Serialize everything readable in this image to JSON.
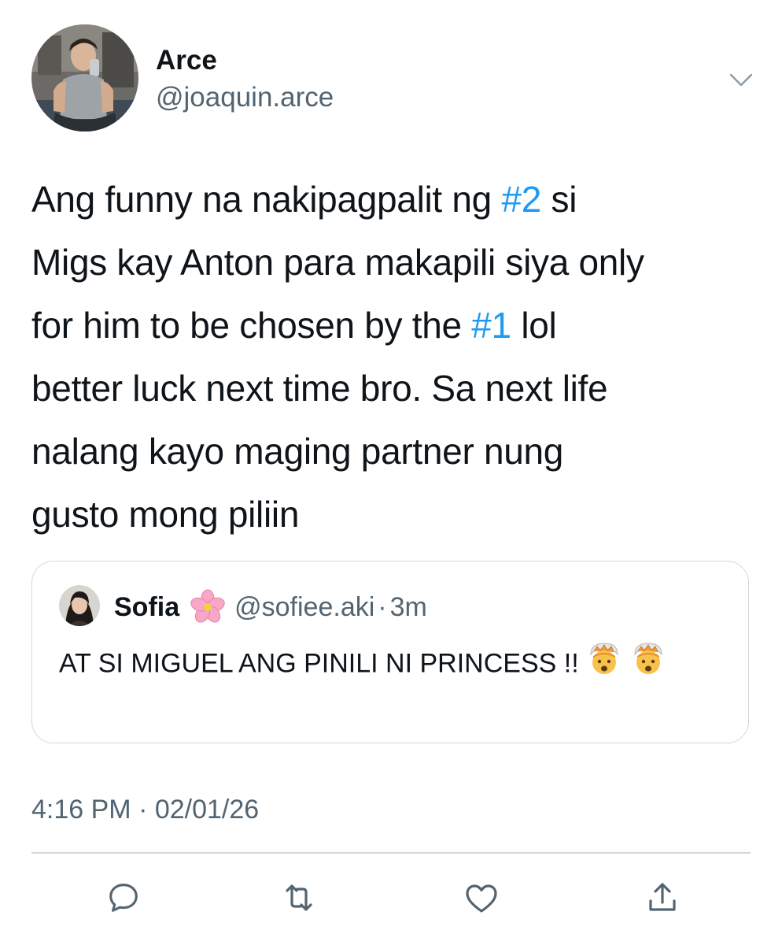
{
  "tweet": {
    "author_name": "Arce",
    "author_handle": "@joaquin.arce",
    "text_lines": [
      [
        {
          "t": "Ang funny na nakipagpalit ng ",
          "h": false
        },
        {
          "t": "#2",
          "h": true
        },
        {
          "t": " si",
          "h": false
        }
      ],
      [
        {
          "t": "Migs kay Anton para makapili siya only",
          "h": false
        }
      ],
      [
        {
          "t": "for him to be chosen by the ",
          "h": false
        },
        {
          "t": "#1",
          "h": true
        },
        {
          "t": " lol",
          "h": false
        }
      ],
      [
        {
          "t": "better luck next time bro. Sa next life",
          "h": false
        }
      ],
      [
        {
          "t": "nalang kayo maging partner nung",
          "h": false
        }
      ],
      [
        {
          "t": "gusto mong piliin",
          "h": false
        }
      ]
    ],
    "timestamp": "4:16 PM · 02/01/26"
  },
  "quote": {
    "name": "Sofia",
    "name_emoji": "🌸",
    "handle": "@sofiee.aki",
    "separator": "·",
    "time": "3m",
    "text": "AT SI MIGUEL ANG PINILI NI PRINCESS !!",
    "text_emoji": "🤯"
  },
  "icons": {
    "menu": "chevron-down-icon",
    "reply": "comment-icon",
    "retweet": "retweet-icon",
    "like": "heart-icon",
    "share": "share-icon"
  },
  "colors": {
    "hashtag": "#1d9bf0",
    "secondary_text": "#536471",
    "border": "#cfd9de",
    "primary_text": "#0f1419"
  }
}
